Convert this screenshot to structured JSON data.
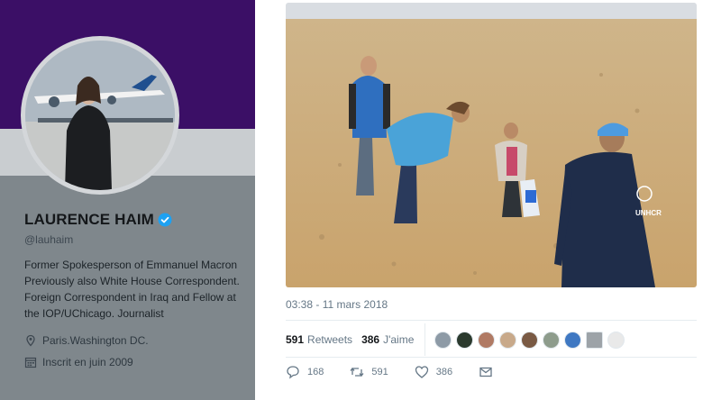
{
  "profile": {
    "name": "LAURENCE HAIM",
    "handle": "@lauhaim",
    "bio": "Former Spokesperson of Emmanuel Macron Previously also White House Correspondent. Foreign Correspondent in Iraq and Fellow at the IOP/UChicago. Journalist",
    "location": "Paris.Washington DC.",
    "joined": "Inscrit en juin 2009",
    "icons": {
      "verified": "verified-badge-icon",
      "location": "location-pin-icon",
      "joined": "calendar-icon"
    },
    "colors": {
      "banner": "#3b0f66",
      "verified": "#1da1f2"
    }
  },
  "tweet": {
    "timestamp": "03:38 - 11 mars 2018",
    "retweets_count": "591",
    "retweets_label": "Retweets",
    "likes_count": "386",
    "likes_label": "J'aime",
    "photo": {
      "vest_logo": "UNHCR"
    },
    "actions": {
      "reply_count": "168",
      "retweet_count": "591",
      "like_count": "386"
    },
    "action_icons": [
      "reply-icon",
      "retweet-icon",
      "heart-icon",
      "message-icon"
    ]
  }
}
